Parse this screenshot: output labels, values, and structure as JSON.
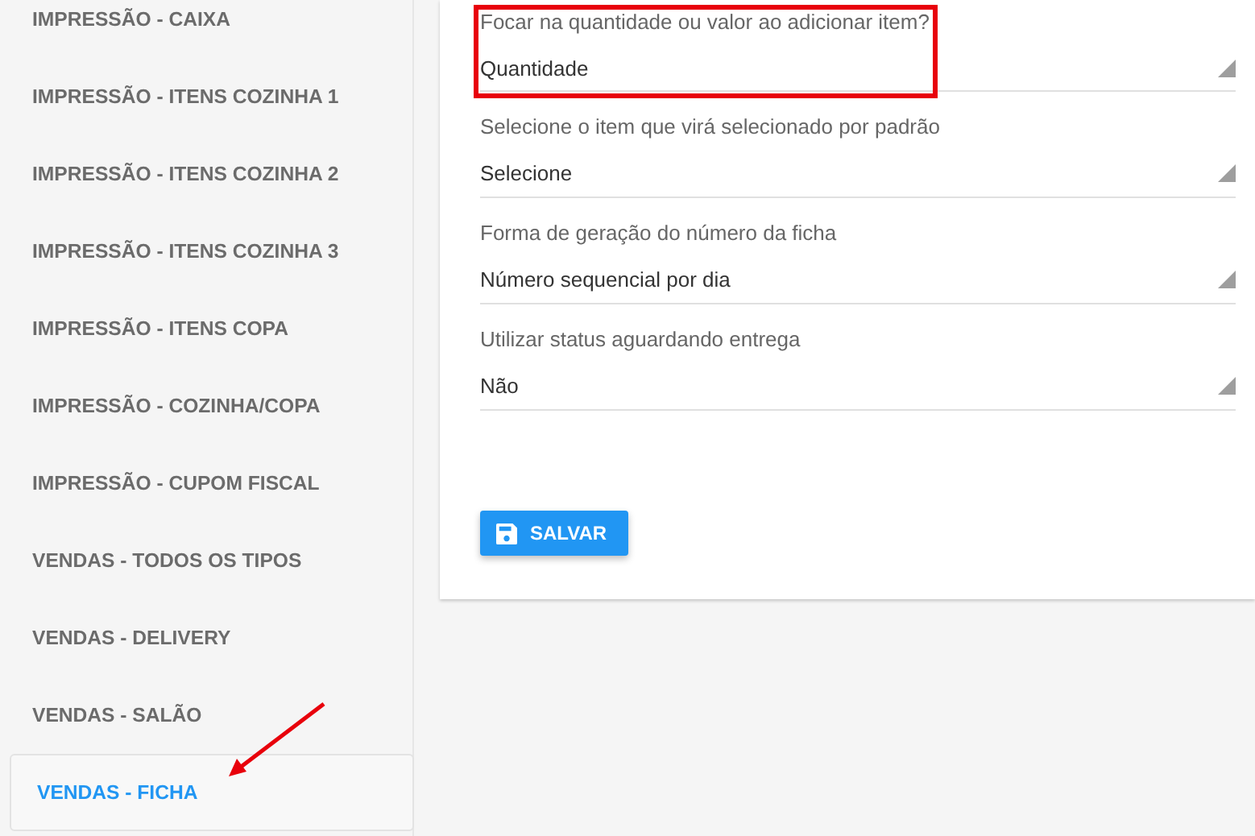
{
  "sidebar": {
    "items": [
      {
        "label": "IMPRESSÃO - CAIXA",
        "selected": false
      },
      {
        "label": "IMPRESSÃO - ITENS COZINHA 1",
        "selected": false
      },
      {
        "label": "IMPRESSÃO - ITENS COZINHA 2",
        "selected": false
      },
      {
        "label": "IMPRESSÃO - ITENS COZINHA 3",
        "selected": false
      },
      {
        "label": "IMPRESSÃO - ITENS COPA",
        "selected": false
      },
      {
        "label": "IMPRESSÃO - COZINHA/COPA",
        "selected": false
      },
      {
        "label": "IMPRESSÃO - CUPOM FISCAL",
        "selected": false
      },
      {
        "label": "VENDAS - TODOS OS TIPOS",
        "selected": false
      },
      {
        "label": "VENDAS - DELIVERY",
        "selected": false
      },
      {
        "label": "VENDAS - SALÃO",
        "selected": false
      },
      {
        "label": "VENDAS - FICHA",
        "selected": true
      }
    ]
  },
  "form": {
    "fields": [
      {
        "label": "Focar na quantidade ou valor ao adicionar item?",
        "value": "Quantidade",
        "highlighted": true
      },
      {
        "label": "Selecione o item que virá selecionado por padrão",
        "value": "Selecione",
        "highlighted": false
      },
      {
        "label": "Forma de geração do número da ficha",
        "value": "Número sequencial por dia",
        "highlighted": false
      },
      {
        "label": "Utilizar status aguardando entrega",
        "value": "Não",
        "highlighted": false
      }
    ],
    "save_button": "SALVAR"
  }
}
